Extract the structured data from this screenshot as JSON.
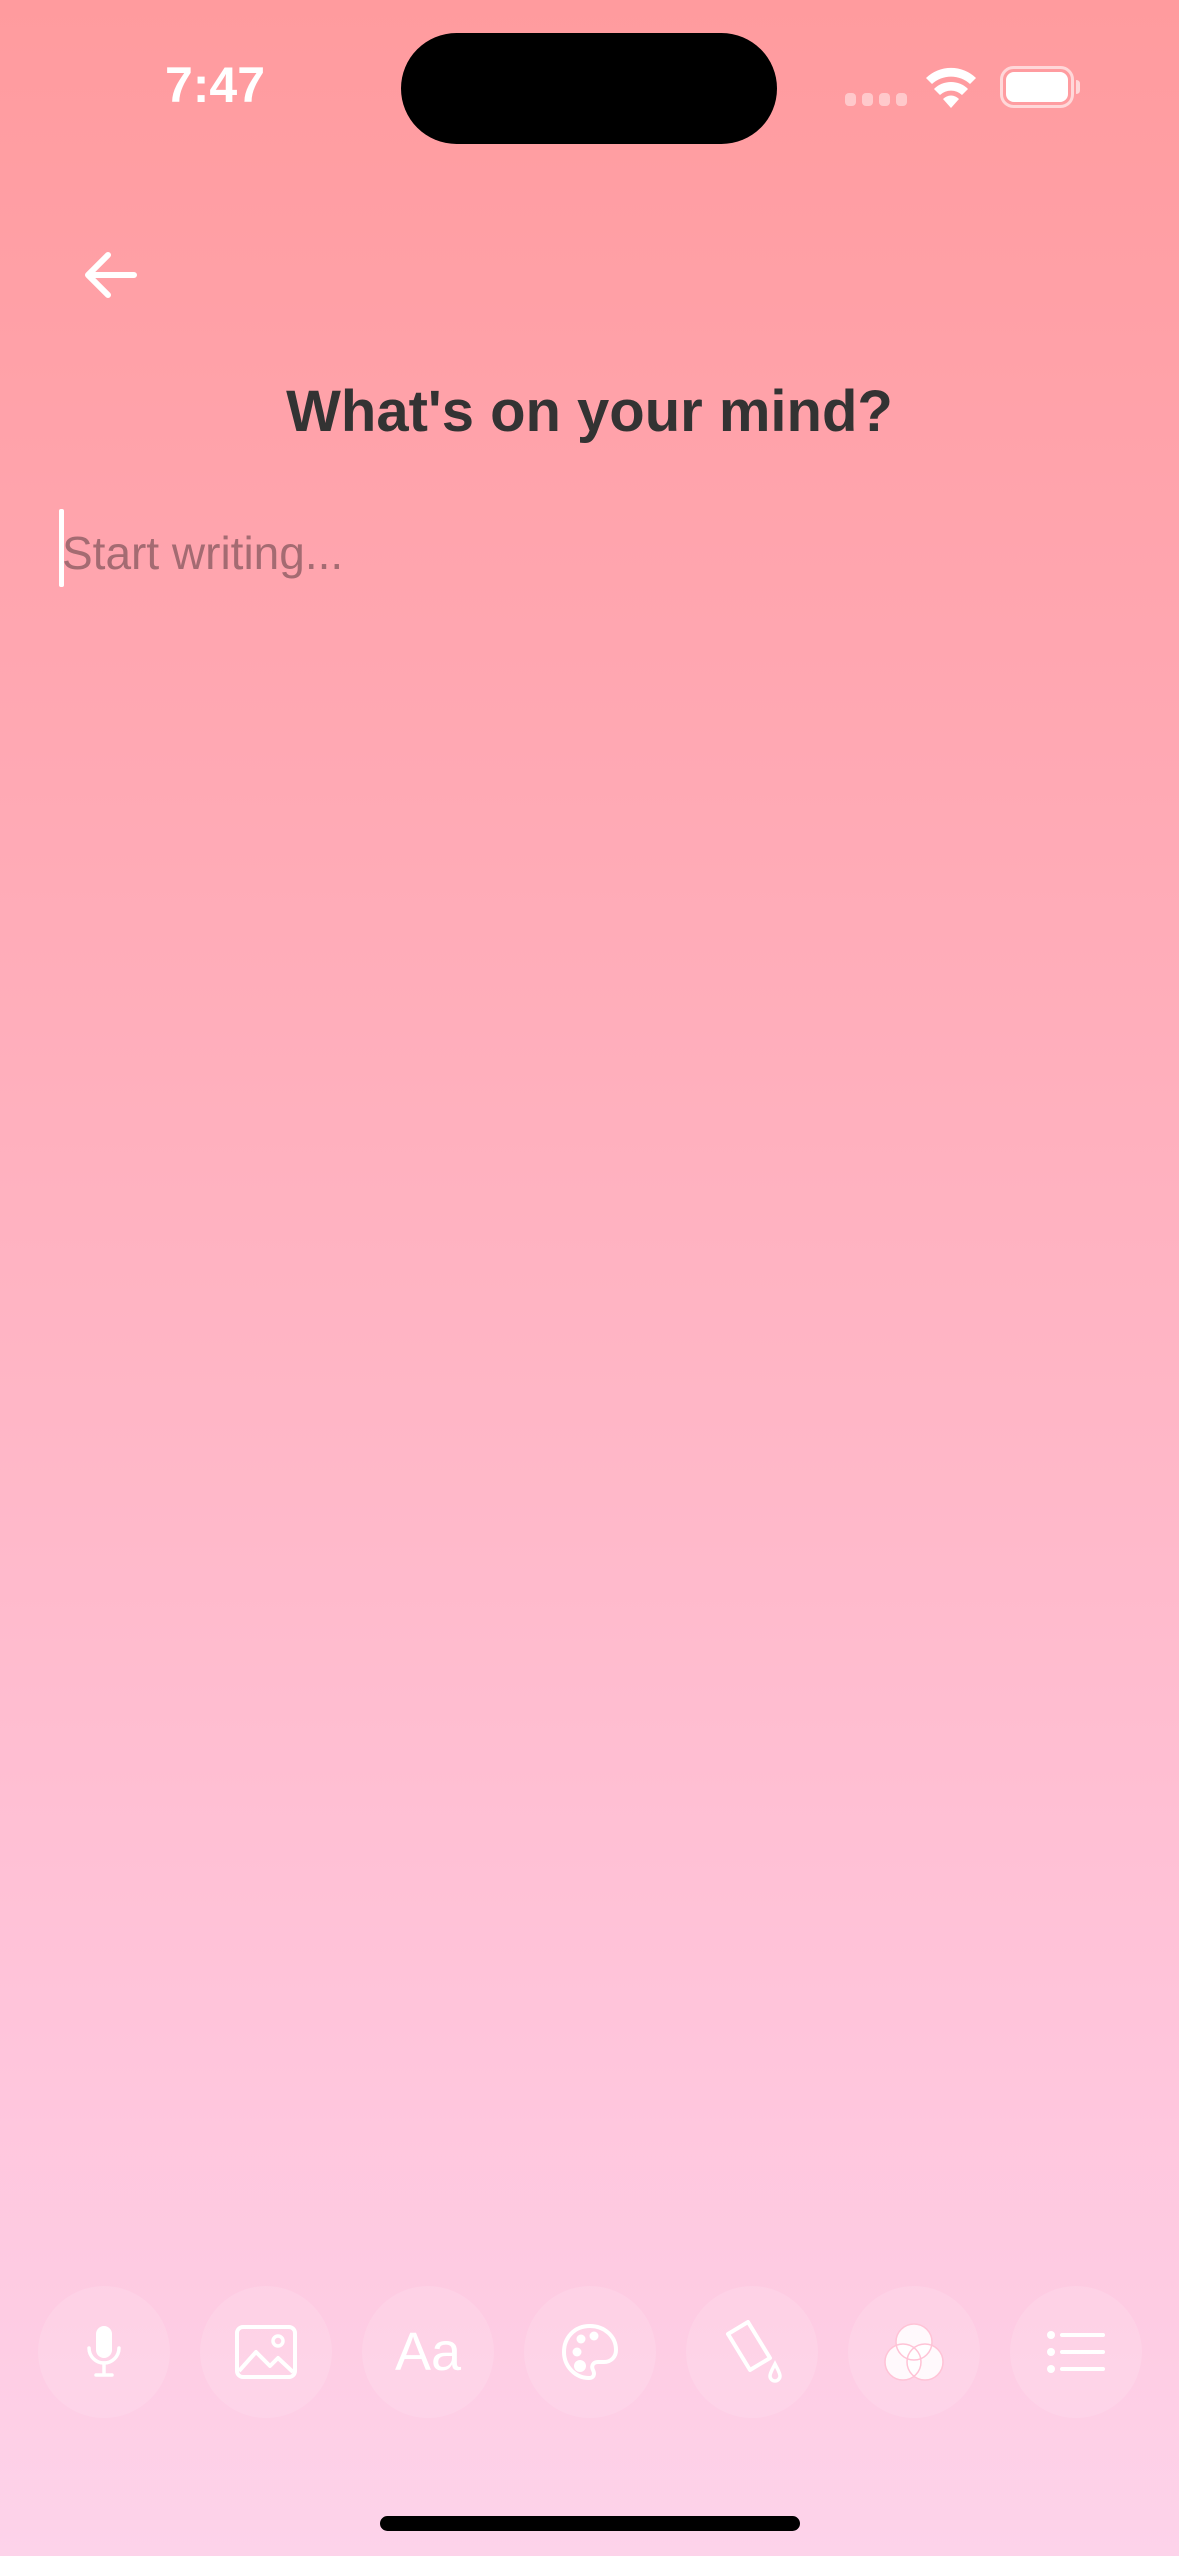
{
  "status_bar": {
    "time": "7:47",
    "icons": [
      "cellular-signal-icon",
      "wifi-icon",
      "battery-icon"
    ]
  },
  "header": {
    "back_icon": "arrow-left-icon",
    "title": "What's on your mind?"
  },
  "editor": {
    "placeholder": "Start writing...",
    "value": ""
  },
  "toolbar": {
    "items": [
      {
        "icon": "microphone-icon",
        "label_text": ""
      },
      {
        "icon": "image-icon",
        "label_text": ""
      },
      {
        "icon": "text-format-icon",
        "label_text": "Aa"
      },
      {
        "icon": "palette-icon",
        "label_text": ""
      },
      {
        "icon": "paint-bucket-icon",
        "label_text": ""
      },
      {
        "icon": "color-filter-icon",
        "label_text": ""
      },
      {
        "icon": "list-icon",
        "label_text": ""
      }
    ]
  },
  "colors": {
    "background_top": "#ff9b9e",
    "background_bottom": "#fdd3ea",
    "title_text": "#333333",
    "icon": "#ffffff"
  }
}
